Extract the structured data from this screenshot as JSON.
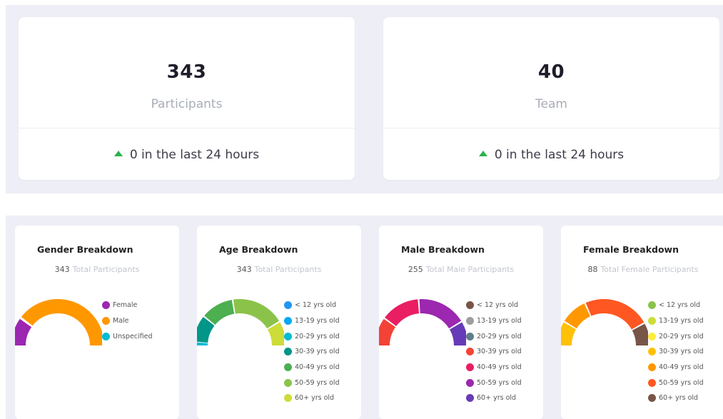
{
  "stats": [
    {
      "value": "343",
      "label": "Participants",
      "delta": "0 in the last 24 hours"
    },
    {
      "value": "40",
      "label": "Team",
      "delta": "0 in the last 24 hours"
    }
  ],
  "delta_color": "#2bb24c",
  "breakdowns": [
    {
      "title": "Gender Breakdown",
      "count": "343",
      "count_label": "Total Participants",
      "legend": [
        {
          "label": "Female",
          "color": "#9c27b0"
        },
        {
          "label": "Male",
          "color": "#ff9800"
        },
        {
          "label": "Unspecified",
          "color": "#00bcd4"
        }
      ],
      "segments": [
        {
          "color": "#9c27b0",
          "start_deg": 180,
          "end_deg": 145
        },
        {
          "color": "#ff9800",
          "start_deg": 142,
          "end_deg": 0
        }
      ]
    },
    {
      "title": "Age Breakdown",
      "count": "343",
      "count_label": "Total Participants",
      "legend": [
        {
          "label": "< 12 yrs old",
          "color": "#2196f3"
        },
        {
          "label": "13-19 yrs old",
          "color": "#03a9f4"
        },
        {
          "label": "20-29 yrs old",
          "color": "#00bcd4"
        },
        {
          "label": "30-39 yrs old",
          "color": "#009688"
        },
        {
          "label": "40-49 yrs old",
          "color": "#4caf50"
        },
        {
          "label": "50-59 yrs old",
          "color": "#8bc34a"
        },
        {
          "label": "60+ yrs old",
          "color": "#cddc39"
        }
      ],
      "segments": [
        {
          "color": "#00bcd4",
          "start_deg": 180,
          "end_deg": 176
        },
        {
          "color": "#009688",
          "start_deg": 175,
          "end_deg": 142
        },
        {
          "color": "#4caf50",
          "start_deg": 140,
          "end_deg": 100
        },
        {
          "color": "#8bc34a",
          "start_deg": 98,
          "end_deg": 32
        },
        {
          "color": "#cddc39",
          "start_deg": 30,
          "end_deg": 0
        }
      ]
    },
    {
      "title": "Male Breakdown",
      "count": "255",
      "count_label": "Total Male Participants",
      "legend": [
        {
          "label": "< 12 yrs old",
          "color": "#795548"
        },
        {
          "label": "13-19 yrs old",
          "color": "#9e9e9e"
        },
        {
          "label": "20-29 yrs old",
          "color": "#607d8b"
        },
        {
          "label": "30-39 yrs old",
          "color": "#f44336"
        },
        {
          "label": "40-49 yrs old",
          "color": "#e91e63"
        },
        {
          "label": "50-59 yrs old",
          "color": "#9c27b0"
        },
        {
          "label": "60+ yrs old",
          "color": "#673ab7"
        }
      ],
      "segments": [
        {
          "color": "#f44336",
          "start_deg": 180,
          "end_deg": 145
        },
        {
          "color": "#e91e63",
          "start_deg": 143,
          "end_deg": 95
        },
        {
          "color": "#9c27b0",
          "start_deg": 93,
          "end_deg": 32
        },
        {
          "color": "#673ab7",
          "start_deg": 30,
          "end_deg": 0
        }
      ]
    },
    {
      "title": "Female Breakdown",
      "count": "88",
      "count_label": "Total Female Participants",
      "legend": [
        {
          "label": "< 12 yrs old",
          "color": "#8bc34a"
        },
        {
          "label": "13-19 yrs old",
          "color": "#cddc39"
        },
        {
          "label": "20-29 yrs old",
          "color": "#ffeb3b"
        },
        {
          "label": "30-39 yrs old",
          "color": "#ffc107"
        },
        {
          "label": "40-49 yrs old",
          "color": "#ff9800"
        },
        {
          "label": "50-59 yrs old",
          "color": "#ff5722"
        },
        {
          "label": "60+ yrs old",
          "color": "#795548"
        }
      ],
      "segments": [
        {
          "color": "#ffc107",
          "start_deg": 180,
          "end_deg": 150
        },
        {
          "color": "#ff9800",
          "start_deg": 148,
          "end_deg": 115
        },
        {
          "color": "#ff5722",
          "start_deg": 113,
          "end_deg": 30
        },
        {
          "color": "#795548",
          "start_deg": 28,
          "end_deg": 0
        }
      ]
    }
  ]
}
